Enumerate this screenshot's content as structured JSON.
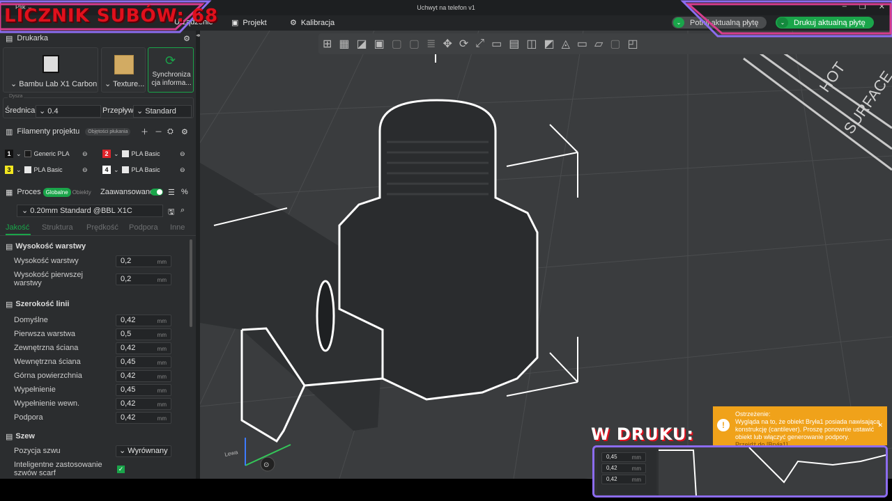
{
  "window": {
    "title": "Uchwyt na telefon v1",
    "menu_label": "Plik"
  },
  "tabs": {
    "device": "Urządzenie",
    "project": "Projekt",
    "calibrate": "Kalibracja"
  },
  "overlay": {
    "sub_counter": "LICZNIK SUBÓW: 68",
    "bottom_banner": "W DRUKU:"
  },
  "toolbar_buttons": {
    "slice": "Potnij aktualną płytę",
    "print": "Drukuj aktualną płytę"
  },
  "printer": {
    "section_title": "Drukarka",
    "printer_name": "Bambu Lab X1 Carbon",
    "plate_name": "Texture...",
    "sync_label": "Synchroniza cja informa...",
    "nozzle_legend": "Dysza",
    "diameter_label": "Średnica",
    "diameter_value": "0.4",
    "flow_label": "Przepływ",
    "flow_value": "Standard"
  },
  "filaments": {
    "title": "Filamenty projektu",
    "purge_badge": "Objętości płukania",
    "items": [
      {
        "num": "1",
        "name": "Generic PLA",
        "color": "#1a1a1a",
        "num_bg": "#111",
        "num_fg": "#fff"
      },
      {
        "num": "2",
        "name": "PLA Basic",
        "color": "#e8e8e8",
        "num_bg": "#e0242b",
        "num_fg": "#fff"
      },
      {
        "num": "3",
        "name": "PLA Basic",
        "color": "#e8e8e8",
        "num_bg": "#f2e620",
        "num_fg": "#111"
      },
      {
        "num": "4",
        "name": "PLA Basic",
        "color": "#e8e8e8",
        "num_bg": "#fff",
        "num_fg": "#111"
      }
    ]
  },
  "process": {
    "title": "Proces",
    "global_tab": "Globalne",
    "objects_tab": "Obiekty",
    "advanced_label": "Zaawansowane",
    "advanced_on": true,
    "profile": "0.20mm Standard @BBL X1C",
    "subtabs": [
      "Jakość",
      "Struktura",
      "Prędkość",
      "Podpora",
      "Inne"
    ]
  },
  "settings": {
    "layer_height_section": "Wysokość warstwy",
    "layer_height_label": "Wysokość warstwy",
    "layer_height_value": "0,2",
    "first_layer_height_label": "Wysokość pierwszej warstwy",
    "first_layer_height_value": "0,2",
    "line_width_section": "Szerokość linii",
    "line_widths": [
      {
        "label": "Domyślne",
        "value": "0,42"
      },
      {
        "label": "Pierwsza warstwa",
        "value": "0,5"
      },
      {
        "label": "Zewnętrzna ściana",
        "value": "0,42"
      },
      {
        "label": "Wewnętrzna ściana",
        "value": "0,45"
      },
      {
        "label": "Górna powierzchnia",
        "value": "0,42"
      },
      {
        "label": "Wypełnienie",
        "value": "0,45"
      },
      {
        "label": "Wypełnienie wewn.",
        "value": "0,42"
      },
      {
        "label": "Podpora",
        "value": "0,42"
      }
    ],
    "unit": "mm",
    "seam_section": "Szew",
    "seam_position_label": "Pozycja szwu",
    "seam_position_value": "Wyrównany",
    "scarf_label": "Inteligentne zastosowanie szwów scarf",
    "scarf_checked": true
  },
  "viewport": {
    "bed_text_1": "HOT",
    "bed_text_2": "SURFACE",
    "axis_label": "Lewa"
  },
  "warning": {
    "title": "Ostrzeżenie:",
    "body": "Wygląda na to, że obiekt Bryła1 posiada nawisającą konstrukcję (cantilever). Proszę ponownie ustawić obiekt lub włączyć generowanie podpory.",
    "link": "Przejdź do [Bryła1]"
  },
  "thumbnail": {
    "values": [
      "0,45",
      "0,42",
      "0,42"
    ],
    "unit": "mm"
  },
  "colors": {
    "accent_green": "#1aa54a",
    "overlay_red": "#e0101c",
    "frame_pink": "#d63c8c",
    "frame_purple": "#8c6cf0",
    "warning_orange": "#f0a21a"
  }
}
